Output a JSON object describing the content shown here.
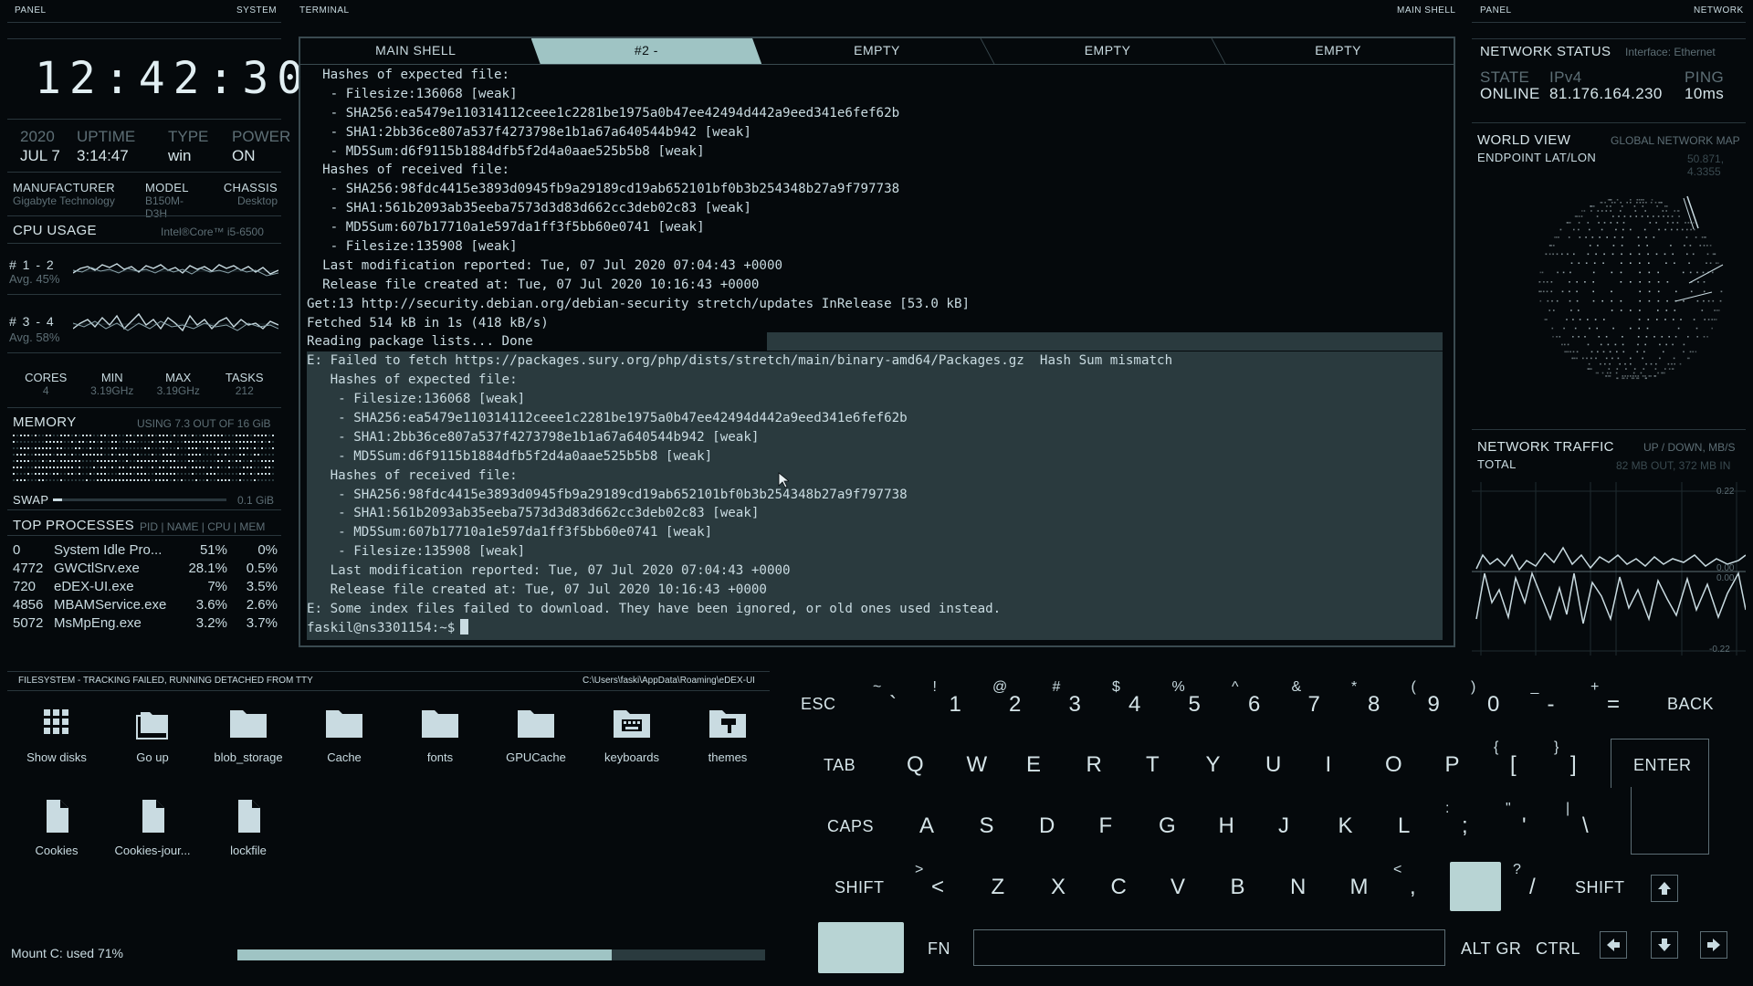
{
  "headers": {
    "panel_left": "PANEL",
    "system": "SYSTEM",
    "terminal": "TERMINAL",
    "main_shell": "MAIN SHELL",
    "panel_right": "PANEL",
    "network": "NETWORK"
  },
  "clock": "12:42:30",
  "system": {
    "year": "2020",
    "date": "JUL 7",
    "uptime_label": "UPTIME",
    "uptime": "3:14:47",
    "type_label": "TYPE",
    "type": "win",
    "power_label": "POWER",
    "power": "ON",
    "manufacturer_label": "MANUFACTURER",
    "manufacturer": "Gigabyte Technology",
    "model_label": "MODEL",
    "model": "B150M-D3H",
    "chassis_label": "CHASSIS",
    "chassis": "Desktop"
  },
  "cpu": {
    "title": "CPU USAGE",
    "name": "Intel®Core™ i5-6500",
    "core1_label": "# 1 - 2",
    "core1_avg": "Avg. 45%",
    "core2_label": "# 3 - 4",
    "core2_avg": "Avg. 58%",
    "cores_label": "CORES",
    "cores": "4",
    "min_label": "MIN",
    "min": "3.19GHz",
    "max_label": "MAX",
    "max": "3.19GHz",
    "tasks_label": "TASKS",
    "tasks": "212"
  },
  "memory": {
    "title": "MEMORY",
    "usage": "USING 7.3 OUT OF 16 GiB",
    "swap_label": "SWAP",
    "swap": "0.1 GiB"
  },
  "processes": {
    "title": "TOP PROCESSES",
    "cols": "PID | NAME | CPU | MEM",
    "rows": [
      {
        "pid": "0",
        "name": "System Idle Pro...",
        "cpu": "51%",
        "mem": "0%"
      },
      {
        "pid": "4772",
        "name": "GWCtlSrv.exe",
        "cpu": "28.1%",
        "mem": "0.5%"
      },
      {
        "pid": "720",
        "name": "eDEX-UI.exe",
        "cpu": "7%",
        "mem": "3.5%"
      },
      {
        "pid": "4856",
        "name": "MBAMService.exe",
        "cpu": "3.6%",
        "mem": "2.6%"
      },
      {
        "pid": "5072",
        "name": "MsMpEng.exe",
        "cpu": "3.2%",
        "mem": "3.7%"
      }
    ]
  },
  "tabs": [
    "MAIN SHELL",
    "#2 -",
    "EMPTY",
    "EMPTY",
    "EMPTY"
  ],
  "terminal_lines": [
    "  Hashes of expected file:",
    "   - Filesize:136068 [weak]",
    "   - SHA256:ea5479e110314112ceee1c2281be1975a0b47ee42494d442a9eed341e6fef62b",
    "   - SHA1:2bb36ce807a537f4273798e1b1a67a640544b942 [weak]",
    "   - MD5Sum:d6f9115b1884dfb5f2d4a0aae525b5b8 [weak]",
    "  Hashes of received file:",
    "   - SHA256:98fdc4415e3893d0945fb9a29189cd19ab652101bf0b3b254348b27a9f797738",
    "   - SHA1:561b2093ab35eeba7573d3d83d662cc3deb02c83 [weak]",
    "   - MD5Sum:607b17710a1e597da1ff3f5bb60e0741 [weak]",
    "   - Filesize:135908 [weak]",
    "  Last modification reported: Tue, 07 Jul 2020 07:04:43 +0000",
    "  Release file created at: Tue, 07 Jul 2020 10:16:43 +0000",
    "Get:13 http://security.debian.org/debian-security stretch/updates InRelease [53.0 kB]",
    "Fetched 514 kB in 1s (418 kB/s)",
    "Reading package lists... Done",
    "E: Failed to fetch https://packages.sury.org/php/dists/stretch/main/binary-amd64/Packages.gz  Hash Sum mismatch",
    "   Hashes of expected file:",
    "    - Filesize:136068 [weak]",
    "    - SHA256:ea5479e110314112ceee1c2281be1975a0b47ee42494d442a9eed341e6fef62b",
    "    - SHA1:2bb36ce807a537f4273798e1b1a67a640544b942 [weak]",
    "    - MD5Sum:d6f9115b1884dfb5f2d4a0aae525b5b8 [weak]",
    "   Hashes of received file:",
    "    - SHA256:98fdc4415e3893d0945fb9a29189cd19ab652101bf0b3b254348b27a9f797738",
    "    - SHA1:561b2093ab35eeba7573d3d83d662cc3deb02c83 [weak]",
    "    - MD5Sum:607b17710a1e597da1ff3f5bb60e0741 [weak]",
    "    - Filesize:135908 [weak]",
    "   Last modification reported: Tue, 07 Jul 2020 07:04:43 +0000",
    "   Release file created at: Tue, 07 Jul 2020 10:16:43 +0000",
    "E: Some index files failed to download. They have been ignored, or old ones used instead."
  ],
  "prompt": "faskil@ns3301154:~$",
  "network": {
    "status_title": "NETWORK STATUS",
    "interface": "Interface: Ethernet",
    "state_label": "STATE",
    "state": "ONLINE",
    "ip_label": "IPv4",
    "ip": "81.176.164.230",
    "ping_label": "PING",
    "ping": "10ms",
    "world_title": "WORLD VIEW",
    "world_sub": "GLOBAL NETWORK MAP",
    "endpoint_label": "ENDPOINT LAT/LON",
    "endpoint": "50.871, 4.3355",
    "traffic_title": "NETWORK TRAFFIC",
    "traffic_sub": "UP / DOWN, MB/S",
    "total_label": "TOTAL",
    "total": "82 MB OUT, 372 MB IN",
    "graph_top": "0.22",
    "graph_mid1": "0.00",
    "graph_mid2": "0.00",
    "graph_bottom": "-0.22"
  },
  "filesystem": {
    "status": "FILESYSTEM - TRACKING FAILED, RUNNING DETACHED FROM TTY",
    "path": "C:\\Users\\faski\\AppData\\Roaming\\eDEX-UI",
    "items": [
      "Show disks",
      "Go up",
      "blob_storage",
      "Cache",
      "fonts",
      "GPUCache",
      "keyboards",
      "themes",
      "Cookies",
      "Cookies-jour...",
      "lockfile"
    ],
    "mount": "Mount C: used 71%",
    "mount_used": 0.71
  },
  "keyboard": {
    "esc": "ESC",
    "back": "BACK",
    "tab": "TAB",
    "enter": "ENTER",
    "caps": "CAPS",
    "shift": "SHIFT",
    "fn": "FN",
    "altgr": "ALT GR",
    "ctrl": "CTRL",
    "row1": [
      [
        "~",
        "`"
      ],
      [
        "!",
        "1"
      ],
      [
        "@",
        "2"
      ],
      [
        "#",
        "3"
      ],
      [
        "$",
        "4"
      ],
      [
        "%",
        "5"
      ],
      [
        "^",
        "6"
      ],
      [
        "&",
        "7"
      ],
      [
        "*",
        "8"
      ],
      [
        "(",
        "9"
      ],
      [
        ")",
        "0"
      ],
      [
        "_",
        "-"
      ],
      [
        "+",
        "="
      ]
    ],
    "row2": [
      "Q",
      "W",
      "E",
      "R",
      "T",
      "Y",
      "U",
      "I",
      "O",
      "P"
    ],
    "row2_extra": [
      [
        "{",
        "["
      ],
      [
        "}",
        "]"
      ]
    ],
    "row3": [
      "A",
      "S",
      "D",
      "F",
      "G",
      "H",
      "J",
      "K",
      "L"
    ],
    "row3_extra": [
      [
        ":",
        ";"
      ],
      [
        "\"",
        "'"
      ],
      [
        "|",
        "\\"
      ]
    ],
    "row4": [
      [
        ">",
        "<"
      ],
      [
        "",
        "Z"
      ],
      [
        "",
        "X"
      ],
      [
        "",
        "C"
      ],
      [
        "",
        "V"
      ],
      [
        "",
        "B"
      ],
      [
        "",
        "N"
      ],
      [
        "",
        "M"
      ],
      [
        "<",
        ","
      ],
      [
        "",
        ""
      ],
      [
        "?",
        "/"
      ]
    ]
  },
  "colors": {
    "accent": "#9fc4c4",
    "background": "#05090c",
    "text": "#c9dbe1",
    "muted": "#5d6e75",
    "selection": "#2a3a3e"
  }
}
